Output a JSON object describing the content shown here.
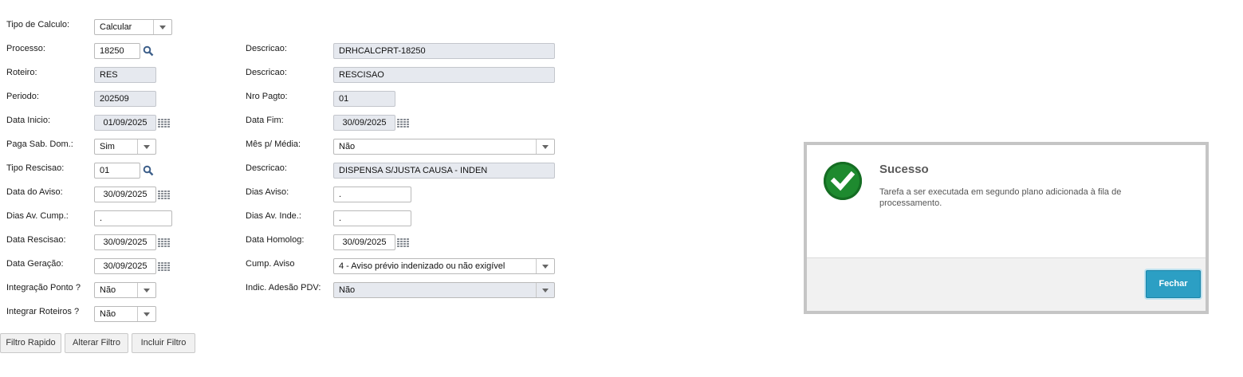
{
  "form": {
    "tipo_calculo": {
      "label": "Tipo de Calculo:",
      "value": "Calcular"
    },
    "processo": {
      "label": "Processo:",
      "value": "18250"
    },
    "processo_desc": {
      "label": "Descricao:",
      "value": "DRHCALCPRT-18250"
    },
    "roteiro": {
      "label": "Roteiro:",
      "value": "RES"
    },
    "roteiro_desc": {
      "label": "Descricao:",
      "value": "RESCISAO"
    },
    "periodo": {
      "label": "Periodo:",
      "value": "202509"
    },
    "nro_pagto": {
      "label": "Nro Pagto:",
      "value": "01"
    },
    "data_inicio": {
      "label": "Data Inicio:",
      "value": "01/09/2025"
    },
    "data_fim": {
      "label": "Data Fim:",
      "value": "30/09/2025"
    },
    "paga_sab_dom": {
      "label": "Paga Sab. Dom.:",
      "value": "Sim"
    },
    "mes_media": {
      "label": "Mês p/ Média:",
      "value": "Não"
    },
    "tipo_rescisao": {
      "label": "Tipo Rescisao:",
      "value": "01"
    },
    "tipo_rescisao_desc": {
      "label": "Descricao:",
      "value": "DISPENSA S/JUSTA CAUSA - INDEN"
    },
    "data_aviso": {
      "label": "Data do Aviso:",
      "value": "30/09/2025"
    },
    "dias_aviso": {
      "label": "Dias Aviso:",
      "value": "."
    },
    "dias_av_cump": {
      "label": "Dias Av. Cump.:",
      "value": "."
    },
    "dias_av_inde": {
      "label": "Dias Av. Inde.:",
      "value": "."
    },
    "data_rescisao": {
      "label": "Data Rescisao:",
      "value": "30/09/2025"
    },
    "data_homolog": {
      "label": "Data Homolog:",
      "value": "30/09/2025"
    },
    "data_geracao": {
      "label": "Data Geração:",
      "value": "30/09/2025"
    },
    "cump_aviso": {
      "label": "Cump. Aviso",
      "value": "4 - Aviso prévio indenizado ou não exigível"
    },
    "integracao_ponto": {
      "label": "Integração Ponto ?",
      "value": "Não"
    },
    "indic_adesao_pdv": {
      "label": "Indic. Adesão PDV:",
      "value": "Não"
    },
    "integrar_roteiros": {
      "label": "Integrar Roteiros ?",
      "value": "Não"
    }
  },
  "buttons": {
    "filtro_rapido": "Filtro Rapido",
    "alterar_filtro": "Alterar Filtro",
    "incluir_filtro": "Incluir Filtro"
  },
  "modal": {
    "title": "Sucesso",
    "message": "Tarefa a ser executada em segundo plano adicionada à fila de processamento.",
    "close_label": "Fechar",
    "accent_color": "#2c9fc4",
    "success_color": "#1e8a2f"
  }
}
